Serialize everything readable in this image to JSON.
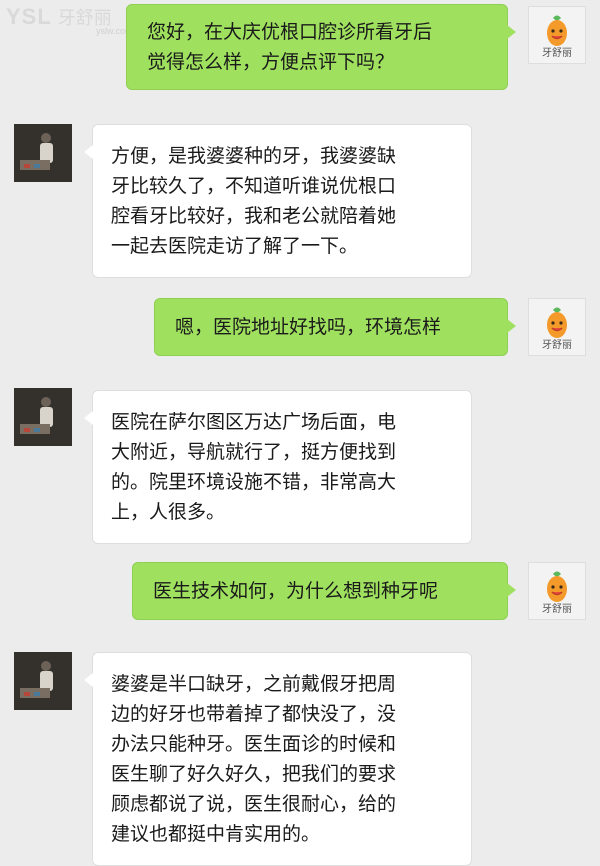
{
  "watermark": {
    "brand": "YSL",
    "cn": "牙舒丽",
    "url": "yslw.com"
  },
  "avatar_label": "牙舒丽",
  "messages": [
    {
      "side": "out",
      "lines": [
        "您好，在大庆优根口腔诊所看牙后",
        "觉得怎么样，方便点评下吗？"
      ]
    },
    {
      "side": "in",
      "lines": [
        "方便，是我婆婆种的牙，我婆婆缺",
        "牙比较久了，不知道听谁说优根口",
        "腔看牙比较好，我和老公就陪着她",
        "一起去医院走访了解了一下。"
      ]
    },
    {
      "side": "out",
      "lines": [
        "嗯，医院地址好找吗，环境怎样"
      ]
    },
    {
      "side": "in",
      "lines": [
        "医院在萨尔图区万达广场后面，电",
        "大附近，导航就行了，挺方便找到",
        "的。院里环境设施不错，非常高大",
        "上，人很多。"
      ]
    },
    {
      "side": "out",
      "lines": [
        "医生技术如何，为什么想到种牙呢"
      ]
    },
    {
      "side": "in",
      "lines": [
        "婆婆是半口缺牙，之前戴假牙把周",
        "边的好牙也带着掉了都快没了，没",
        "办法只能种牙。医生面诊的时候和",
        "医生聊了好久好久，把我们的要求",
        "顾虑都说了说，医生很耐心，给的",
        "建议也都挺中肯实用的。"
      ]
    }
  ]
}
